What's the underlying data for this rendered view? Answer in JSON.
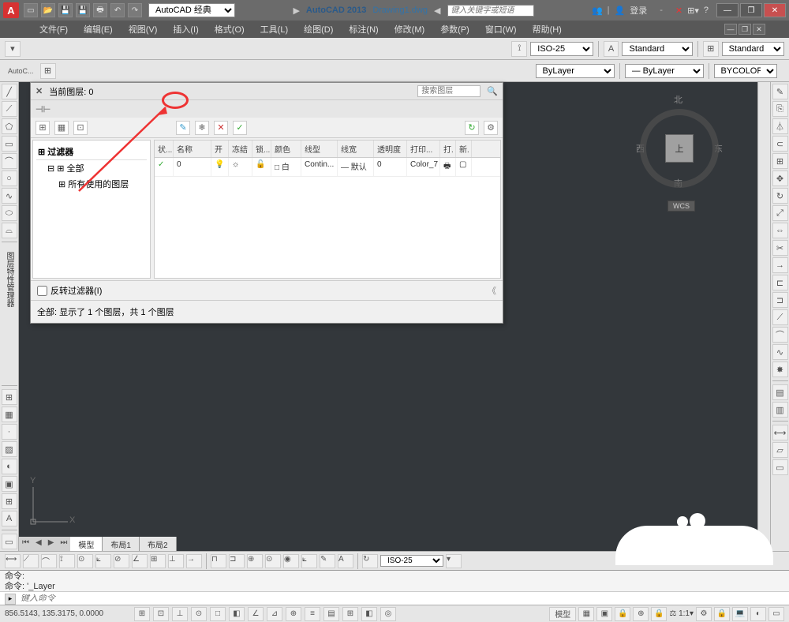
{
  "title": {
    "app": "AutoCAD 2013",
    "file": "Drawing1.dwg",
    "workspace": "AutoCAD 经典",
    "search_keyword": "键入关键字或短语",
    "login": "登录"
  },
  "menu": {
    "file": "文件(F)",
    "edit": "编辑(E)",
    "view": "视图(V)",
    "insert": "插入(I)",
    "format": "格式(O)",
    "tools": "工具(L)",
    "draw": "绘图(D)",
    "dimension": "标注(N)",
    "modify": "修改(M)",
    "parametric": "参数(P)",
    "window": "窗口(W)",
    "help": "帮助(H)"
  },
  "props": {
    "dimstyle": "ISO-25",
    "textstyle": "Standard",
    "tablestyle": "Standard",
    "color": "ByLayer",
    "linetype": "ByLayer",
    "bycolor": "BYCOLOR",
    "autocad_label": "AutoC..."
  },
  "layer_panel": {
    "current_layer_label": "当前图层: 0",
    "search_placeholder": "搜索图层",
    "filter_header": "过滤器",
    "filter_all": "全部",
    "filter_used": "所有使用的图层",
    "invert_filter": "反转过滤器(I)",
    "status_footer": "全部: 显示了 1 个图层，共 1 个图层",
    "cols": {
      "status": "状...",
      "name": "名称",
      "on": "开",
      "freeze": "冻结",
      "lock": "锁...",
      "color": "颜色",
      "linetype": "线型",
      "lineweight": "线宽",
      "transparency": "透明度",
      "plot": "打印...",
      "print": "打.",
      "new": "新."
    },
    "row0": {
      "status": "✓",
      "name": "0",
      "on": "💡",
      "freeze": "☼",
      "lock": "🔓",
      "colorbox": "□",
      "colorname": "白",
      "linetype": "Contin...",
      "lineweight": "— 默认",
      "transparency": "0",
      "plot": "Color_7",
      "print": "🖶"
    },
    "side_label": "图层特性管理器"
  },
  "viewcube": {
    "n": "北",
    "s": "南",
    "e": "东",
    "w": "西",
    "top": "上",
    "wcs": "WCS"
  },
  "ucs": {
    "x": "X",
    "y": "Y"
  },
  "layout_tabs": {
    "model": "模型",
    "layout1": "布局1",
    "layout2": "布局2"
  },
  "lower_toolbar": {
    "dimstyle": "ISO-25"
  },
  "cmdline": {
    "line1": "命令:",
    "line2": "命令: '_Layer",
    "input_placeholder": "键入命令"
  },
  "statusbar": {
    "coords": "856.5143, 135.3175, 0.0000",
    "model_btn": "模型",
    "scale": "1:1"
  }
}
